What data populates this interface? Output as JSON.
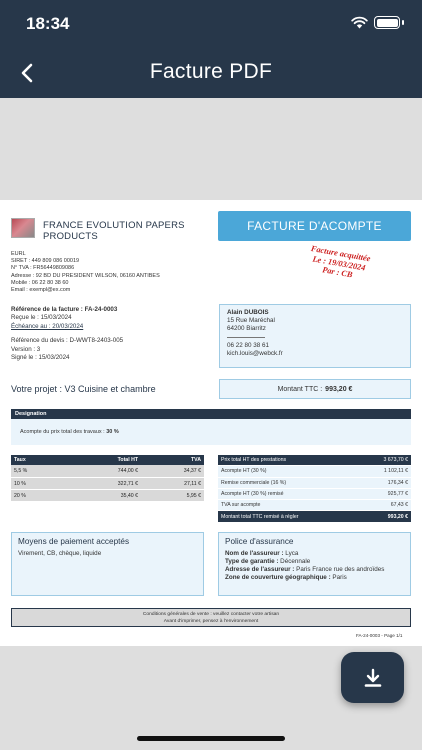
{
  "status_bar": {
    "time": "18:34",
    "icons": [
      "wifi-icon",
      "battery-icon"
    ]
  },
  "nav": {
    "title": "Facture PDF",
    "back_icon": "chevron-left-icon"
  },
  "colors": {
    "header": "#27374a",
    "accent": "#4ba7d8",
    "panel": "#eaf4fb",
    "stamp": "#cc1e1e"
  },
  "document": {
    "company": {
      "name": "FRANCE EVOLUTION PAPERS PRODUCTS",
      "info": [
        "EURL",
        "SIRET : 449 809 086 00019",
        "N° TVA : FR56449809086",
        "Adresse : 92 BD DU PRESIDENT WILSON, 06160 ANTIBES",
        "Mobile : 06 22 80 38 60",
        "Email : exempl@ex.com"
      ]
    },
    "badge": "FACTURE D'ACOMPTE",
    "stamp": {
      "line1": "Facture acquittée",
      "line2": "Le : 19/03/2024",
      "line3": "Par : CB"
    },
    "references": {
      "ref_label": "Référence de la facture : ",
      "ref_value": "FA-24-0003",
      "recue": "Reçue le : 15/03/2024",
      "echeance": "Échéance au : 20/03/2024",
      "devis": "Référence du devis : D-WWT8-2403-005",
      "version": "Version : 3",
      "signe": "Signé le : 15/03/2024"
    },
    "client": {
      "name": "Alain DUBOIS",
      "street": "15 Rue Maréchal",
      "city": "64200 Biarritz",
      "phone": "06 22 80 38 61",
      "email": "kich.louis@webck.fr"
    },
    "projet": "Votre projet : V3 Cuisine et chambre",
    "montant": {
      "label": "Montant TTC : ",
      "value": "993,20 €"
    },
    "designation": {
      "header": "Designation",
      "text": "Acompte du prix total des travaux : ",
      "pct": "30 %"
    },
    "tva_table": {
      "headers": [
        "Taux",
        "Total HT",
        "TVA"
      ],
      "rows": [
        [
          "5,5 %",
          "744,00 €",
          "34,37 €"
        ],
        [
          "10 %",
          "322,71 €",
          "27,11 €"
        ],
        [
          "20 %",
          "35,40 €",
          "5,95 €"
        ]
      ]
    },
    "totals": [
      {
        "label": "Prix total HT des prestations",
        "value": "3 673,70 €"
      },
      {
        "label": "Acompte HT (30 %)",
        "value": "1 102,11 €"
      },
      {
        "label": "Remise commerciale (16 %)",
        "value": "176,34 €"
      },
      {
        "label": "Acompte HT (30 %) remisé",
        "value": "925,77 €"
      },
      {
        "label": "TVA sur acompte",
        "value": "67,43 €"
      },
      {
        "label": "Montant total TTC remisé à régler",
        "value": "993,20 €"
      }
    ],
    "payment": {
      "title": "Moyens de paiement acceptés",
      "text": "Virement, CB, chèque, liquide"
    },
    "insurance": {
      "title": "Police d'assurance",
      "assureur_label": "Nom de l'assureur : ",
      "assureur": "Lyca",
      "garantie_label": "Type de garantie : ",
      "garantie": "Décennale",
      "adresse_label": "Adresse de l'assureur : ",
      "adresse": "Paris France rue des androïdes",
      "zone_label": "Zone de couverture géographique : ",
      "zone": "Paris"
    },
    "footer": {
      "line1": "Conditions générales de vente : veuillez contacter votre artisan",
      "line2": "Avant d'imprimer, pensez à l'environnement"
    },
    "page_ref": "FA-24-0003 - Page 1/1"
  },
  "fab": {
    "icon": "download-icon"
  }
}
